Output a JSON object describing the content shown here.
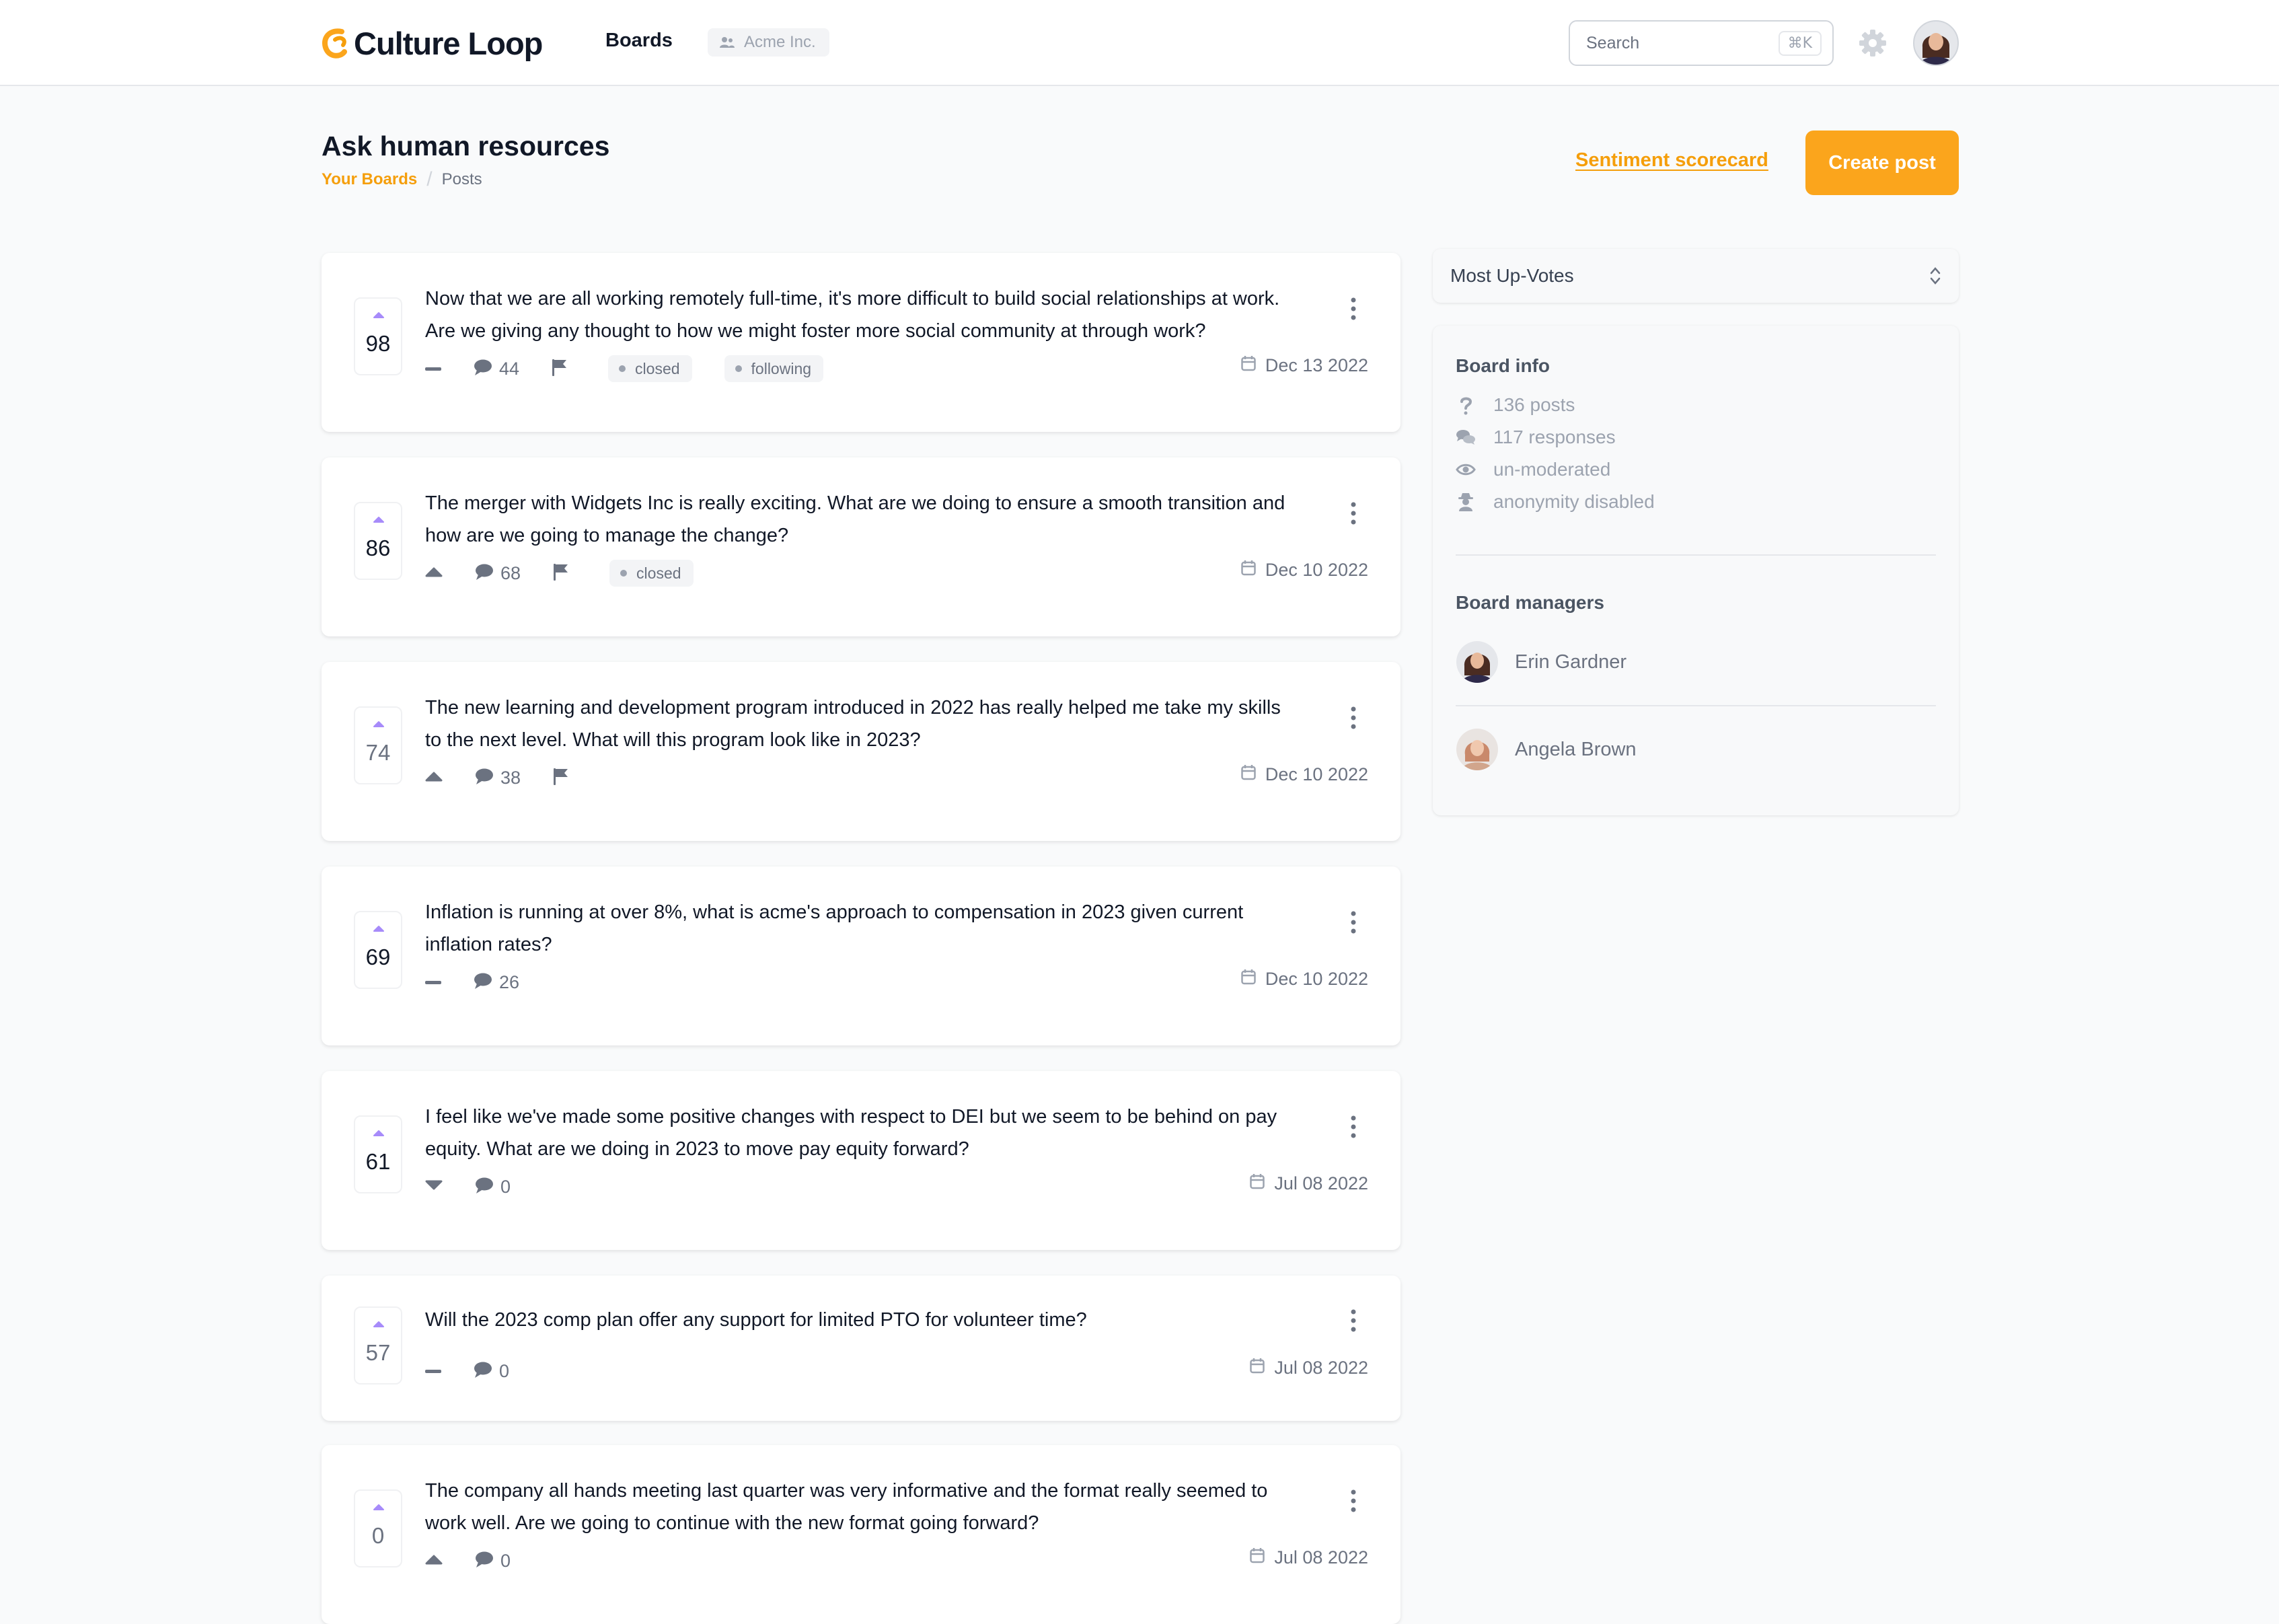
{
  "app": {
    "name": "Culture Loop",
    "brand_color": "#fba51c"
  },
  "nav": {
    "boards": "Boards",
    "org": "Acme Inc."
  },
  "search": {
    "placeholder": "Search",
    "shortcut": "⌘K"
  },
  "page": {
    "title": "Ask human resources",
    "breadcrumb": [
      "Your Boards",
      "Posts"
    ],
    "sentiment_link": "Sentiment scorecard",
    "create_button": "Create post"
  },
  "posts": [
    {
      "votes": "98",
      "text": "Now that we are all working remotely full-time, it's more difficult to build social relationships at work. Are we giving any thought to how we might foster more social community at through work?",
      "comments": "44",
      "vote_state": "neutral",
      "flag": true,
      "tags": [
        "closed",
        "following"
      ],
      "date": "Dec 13 2022"
    },
    {
      "votes": "86",
      "text": "The merger with Widgets Inc is really exciting. What are we doing to ensure a smooth transition and how are we going to manage the change?",
      "comments": "68",
      "vote_state": "up",
      "flag": true,
      "tags": [
        "closed"
      ],
      "date": "Dec 10 2022"
    },
    {
      "votes": "74",
      "text": "The new learning and development program introduced in 2022 has really helped me take my skills to the next level. What will this program look like in 2023?",
      "comments": "38",
      "vote_state": "up",
      "flag": true,
      "tags": [],
      "date": "Dec 10 2022"
    },
    {
      "votes": "69",
      "text": "Inflation is running at over 8%, what is acme's approach to compensation in 2023 given current inflation rates?",
      "comments": "26",
      "vote_state": "neutral",
      "flag": false,
      "tags": [],
      "date": "Dec 10 2022"
    },
    {
      "votes": "61",
      "text": "I feel like we've made some positive changes with respect to DEI but we seem to be behind on pay equity. What are we doing in 2023 to move pay equity forward?",
      "comments": "0",
      "vote_state": "down",
      "flag": false,
      "tags": [],
      "date": "Jul 08 2022"
    },
    {
      "votes": "57",
      "text": "Will the 2023 comp plan offer any support for limited PTO for volunteer time?",
      "comments": "0",
      "vote_state": "neutral",
      "flag": false,
      "tags": [],
      "date": "Jul 08 2022"
    },
    {
      "votes": "0",
      "text": "The company all hands meeting last quarter was very informative and the format really seemed to work well. Are we going to continue with the new format going forward?",
      "comments": "0",
      "vote_state": "up",
      "flag": false,
      "tags": [],
      "date": "Jul 08 2022"
    }
  ],
  "sort": {
    "selected": "Most Up-Votes"
  },
  "board_info": {
    "heading": "Board info",
    "posts": "136 posts",
    "responses": "117 responses",
    "moderation": "un-moderated",
    "anonymity": "anonymity disabled"
  },
  "board_managers": {
    "heading": "Board managers",
    "people": [
      "Erin Gardner",
      "Angela Brown"
    ]
  }
}
